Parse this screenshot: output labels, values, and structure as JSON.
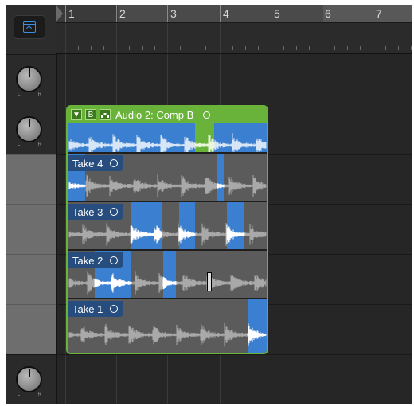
{
  "ruler": {
    "bars": [
      "1",
      "2",
      "3",
      "4",
      "5",
      "6",
      "7"
    ]
  },
  "tracks": [
    {
      "name": "track-1-pan",
      "pan_labels": [
        "L",
        "R"
      ]
    },
    {
      "name": "track-2-pan",
      "pan_labels": [
        "L",
        "R"
      ]
    },
    {
      "name": "track-3-pan",
      "pan_labels": [
        "L",
        "R"
      ]
    }
  ],
  "comp_folder": {
    "collapse_glyph": "▼",
    "b_glyph": "B",
    "title": "Audio 2: Comp B",
    "accent_color": "#6ab33a",
    "selection_color": "#3b7fd1"
  },
  "takes": [
    {
      "label": "Take 4"
    },
    {
      "label": "Take 3"
    },
    {
      "label": "Take 2"
    },
    {
      "label": "Take 1"
    }
  ],
  "icons": {
    "show-inspector": "show-inspector-icon",
    "collapse": "triangle-down-icon",
    "comp-mode": "comp-steps-icon",
    "status": "circle-icon",
    "cursor": "text-cursor-icon"
  }
}
